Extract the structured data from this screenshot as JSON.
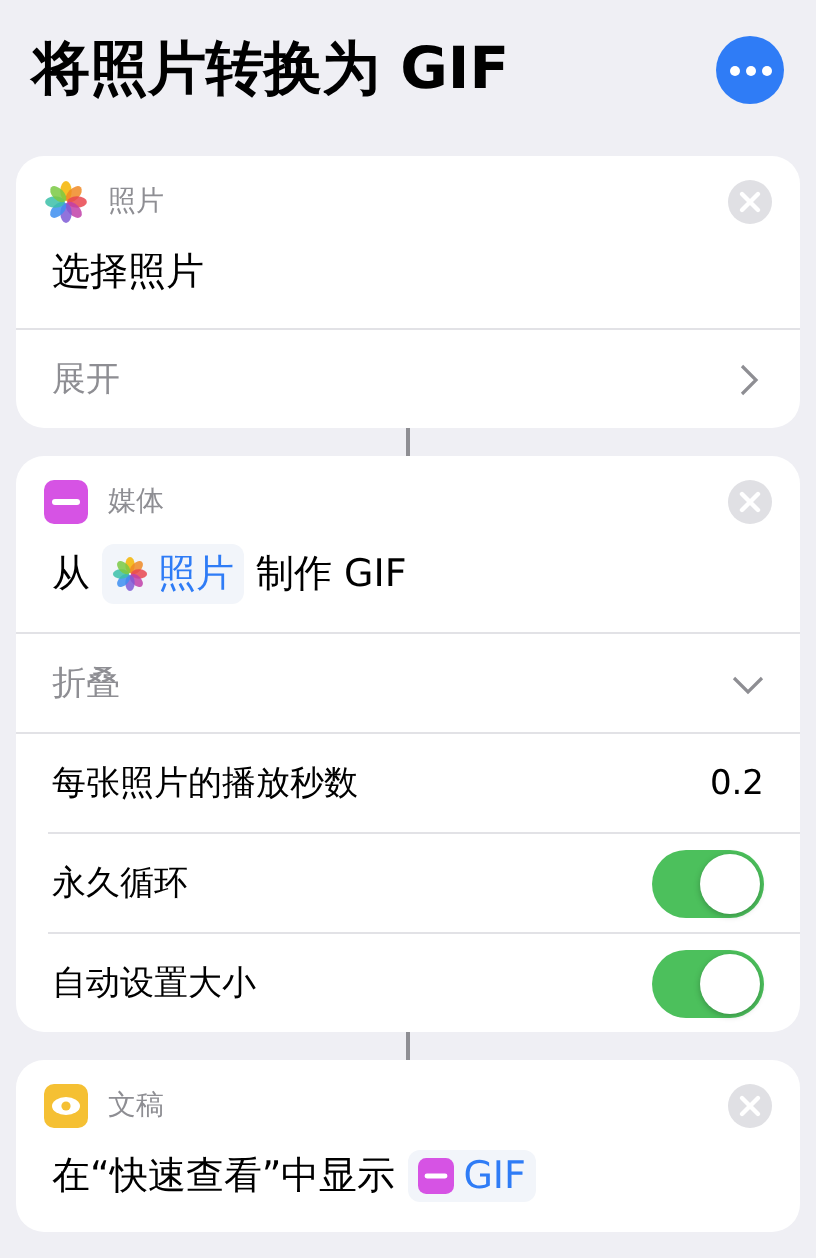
{
  "title": "将照片转换为 GIF",
  "actions": [
    {
      "kind": "photos",
      "category": "照片",
      "title": [
        {
          "kind": "text",
          "text": "选择照片"
        }
      ],
      "toggle_row": {
        "label": "展开",
        "expanded": false
      }
    },
    {
      "kind": "media",
      "category": "媒体",
      "title": [
        {
          "kind": "text",
          "text": "从"
        },
        {
          "kind": "photos",
          "text": "照片"
        },
        {
          "kind": "text",
          "text": "制作 GIF"
        }
      ],
      "toggle_row": {
        "label": "折叠",
        "expanded": true
      },
      "params": [
        {
          "kind": "value",
          "label": "每张照片的播放秒数",
          "value": "0.2"
        },
        {
          "kind": "switch",
          "label": "永久循环",
          "on": true
        },
        {
          "kind": "switch",
          "label": "自动设置大小",
          "on": true
        }
      ]
    },
    {
      "kind": "quicklook",
      "category": "文稿",
      "title": [
        {
          "kind": "text",
          "text": "在“快速查看”中显示"
        },
        {
          "kind": "media",
          "text": "GIF"
        }
      ]
    }
  ]
}
